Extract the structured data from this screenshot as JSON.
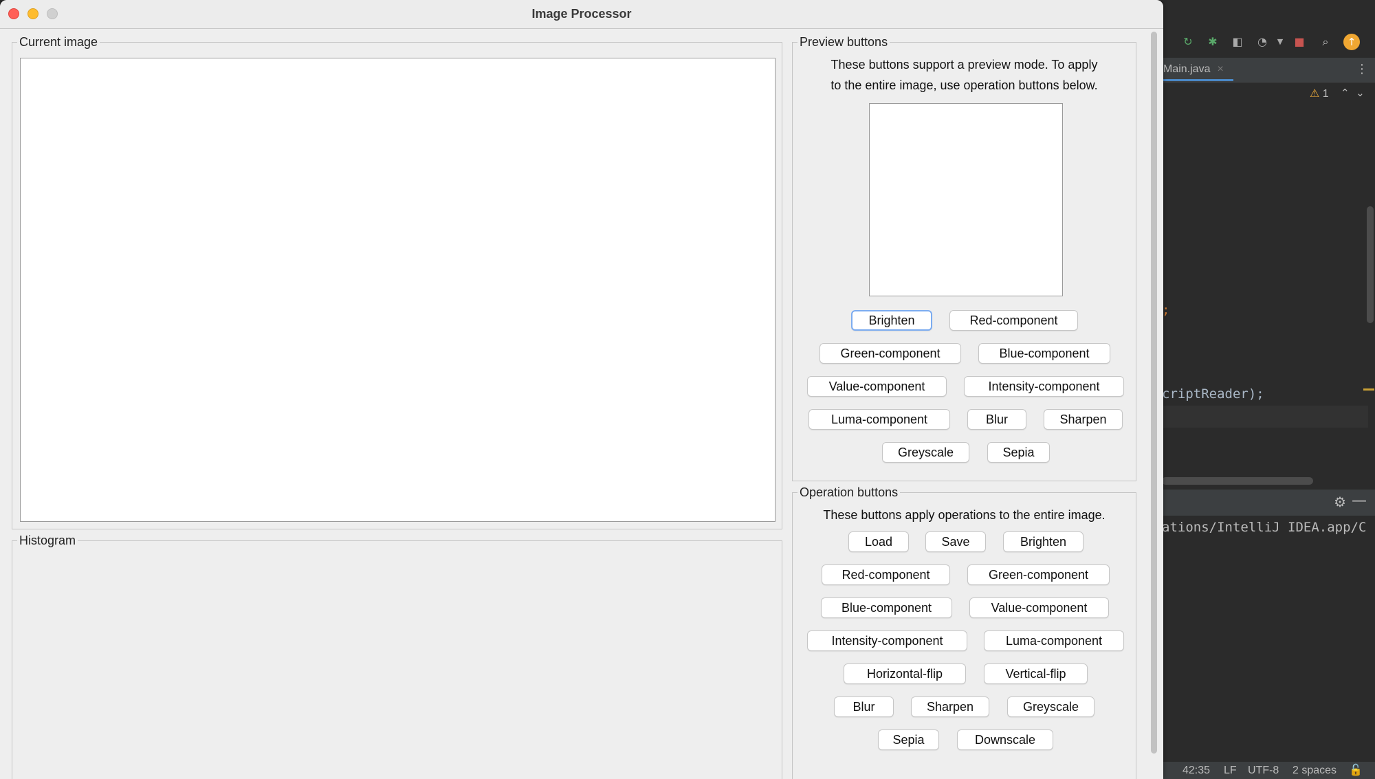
{
  "window": {
    "title": "Image Processor"
  },
  "current_image": {
    "legend": "Current image"
  },
  "histogram": {
    "legend": "Histogram"
  },
  "preview": {
    "legend": "Preview buttons",
    "description_line1": "These buttons support a preview mode. To apply",
    "description_line2": "to the entire image, use operation buttons below.",
    "buttons": {
      "brighten": "Brighten",
      "red": "Red-component",
      "green": "Green-component",
      "blue": "Blue-component",
      "value": "Value-component",
      "intensity": "Intensity-component",
      "luma": "Luma-component",
      "blur": "Blur",
      "sharpen": "Sharpen",
      "greyscale": "Greyscale",
      "sepia": "Sepia"
    }
  },
  "operations": {
    "legend": "Operation buttons",
    "description": "These buttons apply operations to the entire image.",
    "buttons": {
      "load": "Load",
      "save": "Save",
      "brighten": "Brighten",
      "red": "Red-component",
      "green": "Green-component",
      "blue": "Blue-component",
      "value": "Value-component",
      "intensity": "Intensity-component",
      "luma": "Luma-component",
      "hflip": "Horizontal-flip",
      "vflip": "Vertical-flip",
      "blur": "Blur",
      "sharpen": "Sharpen",
      "greyscale": "Greyscale",
      "sepia": "Sepia",
      "downscale": "Downscale"
    }
  },
  "ide": {
    "tab_label": "Main.java",
    "tab_close": "×",
    "more": "⋮",
    "warning_count": "1",
    "code_semicolon": ";",
    "code_line": "criptReader);",
    "console_line": "ations/IntelliJ IDEA.app/C",
    "status": {
      "position": "42:35",
      "line_sep": "LF",
      "encoding": "UTF-8",
      "indent": "2 spaces"
    }
  },
  "colors": {
    "close": "#ff5f57",
    "minimize": "#febc2e",
    "focus_ring": "#7cacf0",
    "ide_bg": "#2b2b2b"
  }
}
